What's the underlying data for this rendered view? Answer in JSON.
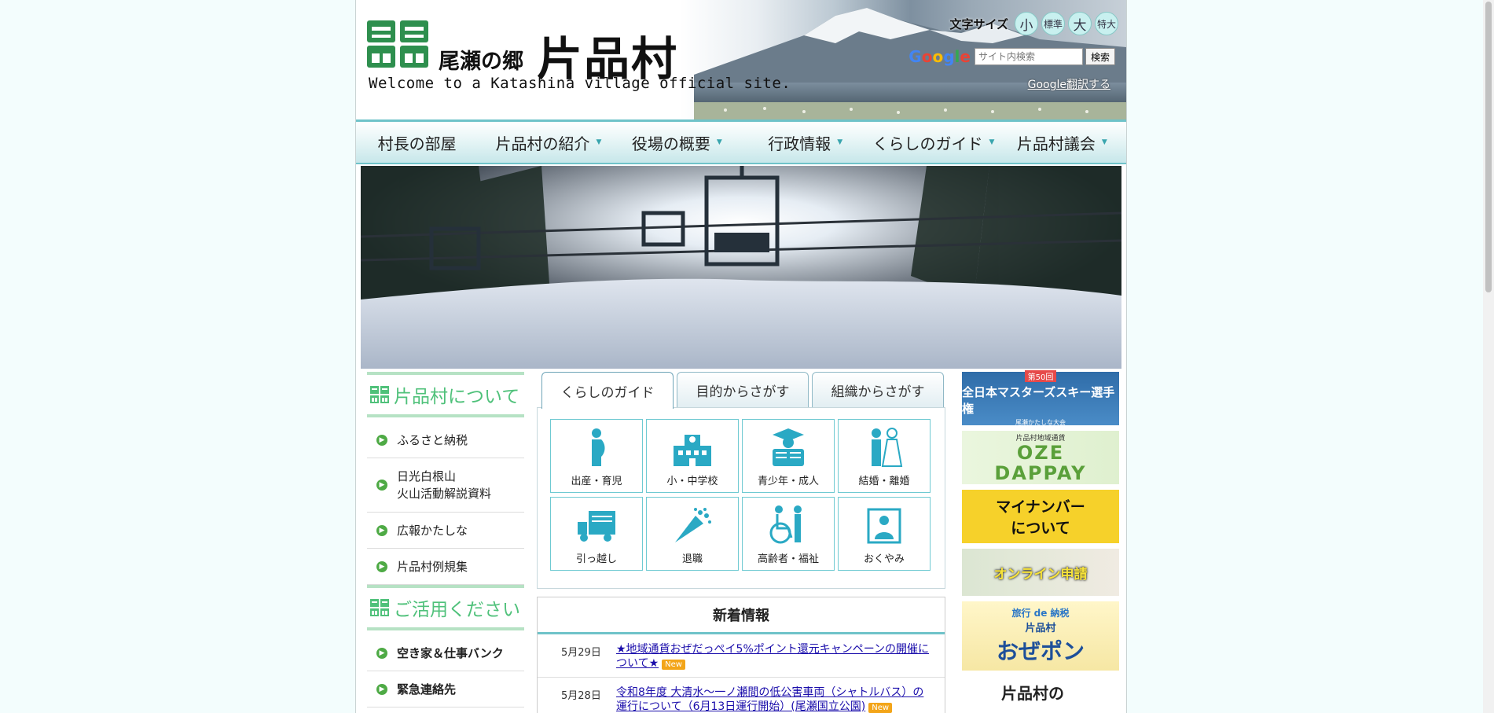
{
  "header": {
    "site_sub": "尾瀬の郷",
    "site_name": "片品村",
    "welcome": "Welcome to a Katashina village official site.",
    "font_size_label": "文字サイズ",
    "font_sizes": [
      "小",
      "標準",
      "大",
      "特大"
    ],
    "google_logo": "Google",
    "search_placeholder": "サイト内検索",
    "search_button": "検索",
    "translate_link": "Google翻訳する"
  },
  "nav": [
    {
      "label": "村長の部屋",
      "caret": ""
    },
    {
      "label": "片品村の紹介",
      "caret": "▼"
    },
    {
      "label": "役場の概要",
      "caret": "▼"
    },
    {
      "label": "行政情報",
      "caret": "▼"
    },
    {
      "label": "くらしのガイド",
      "caret": "▼"
    },
    {
      "label": "片品村議会",
      "caret": "▼"
    }
  ],
  "sidebar": {
    "section1_title": "片品村について",
    "section1_items": [
      "ふるさと納税",
      "日光白根山\n火山活動解説資料",
      "広報かたしな",
      "片品村例規集"
    ],
    "section2_title": "ご活用ください",
    "section2_items": [
      "空き家＆仕事バンク",
      "緊急連絡先"
    ]
  },
  "tabs": [
    "くらしのガイド",
    "目的からさがす",
    "組織からさがす"
  ],
  "tiles": [
    "出産・育児",
    "小・中学校",
    "青少年・成人",
    "結婚・離婚",
    "引っ越し",
    "退職",
    "高齢者・福祉",
    "おくやみ"
  ],
  "news": {
    "title": "新着情報",
    "badge": "New",
    "items": [
      {
        "date": "5月29日",
        "text": "★地域通貨おぜだっぺイ5%ポイント還元キャンペーンの開催について★"
      },
      {
        "date": "5月28日",
        "text": "令和8年度 大清水〜一ノ瀬間の低公害車両（シャトルバス）の運行について（6月13日運行開始）(尾瀬国立公園)"
      }
    ]
  },
  "banners": {
    "b1_line1": "第50回",
    "b1_line2": "全日本マスターズスキー選手権",
    "b1_line3": "尾瀬かたしな大会",
    "b2_line1": "片品村地域通貨",
    "b2_line2": "OZE",
    "b2_line3": "DAPPAY",
    "b3_line1": "マイナンバー",
    "b3_line2": "について",
    "b4_line1": "オンライン申請",
    "b5_line1": "旅行 de 納税",
    "b5_line2": "片品村",
    "b5_line3": "おぜポン",
    "b6_line1": "片品村の"
  },
  "colors": {
    "accent": "#6fc3c9",
    "side_green": "#4fc17a",
    "link": "#1a0dab",
    "new_badge": "#f3a519"
  }
}
